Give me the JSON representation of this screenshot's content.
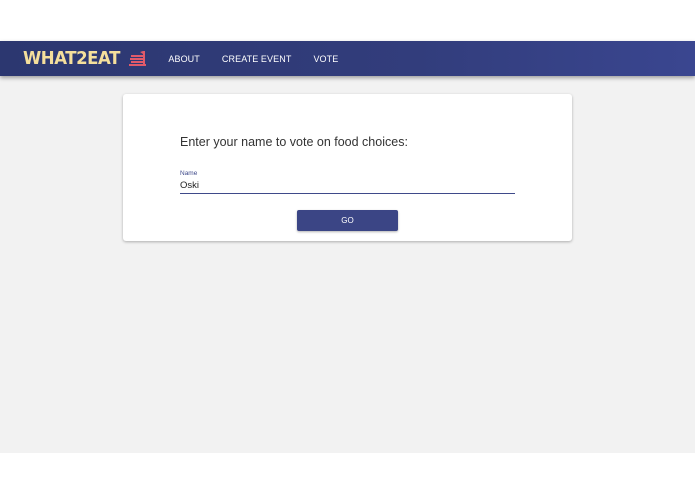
{
  "brand": {
    "name": "WHAT2EAT",
    "icon": "food-stack-icon",
    "color": "#f5df9c",
    "icon_color": "#e05a6a"
  },
  "nav": {
    "items": [
      {
        "label": "ABOUT"
      },
      {
        "label": "CREATE EVENT"
      },
      {
        "label": "VOTE"
      }
    ]
  },
  "card": {
    "prompt": "Enter your name to vote on food choices:",
    "name_field": {
      "label": "Name",
      "value": "Oski"
    },
    "submit_label": "GO"
  },
  "colors": {
    "appbar": "#323d7c",
    "accent": "#3b4585",
    "background": "#f2f2f2"
  }
}
